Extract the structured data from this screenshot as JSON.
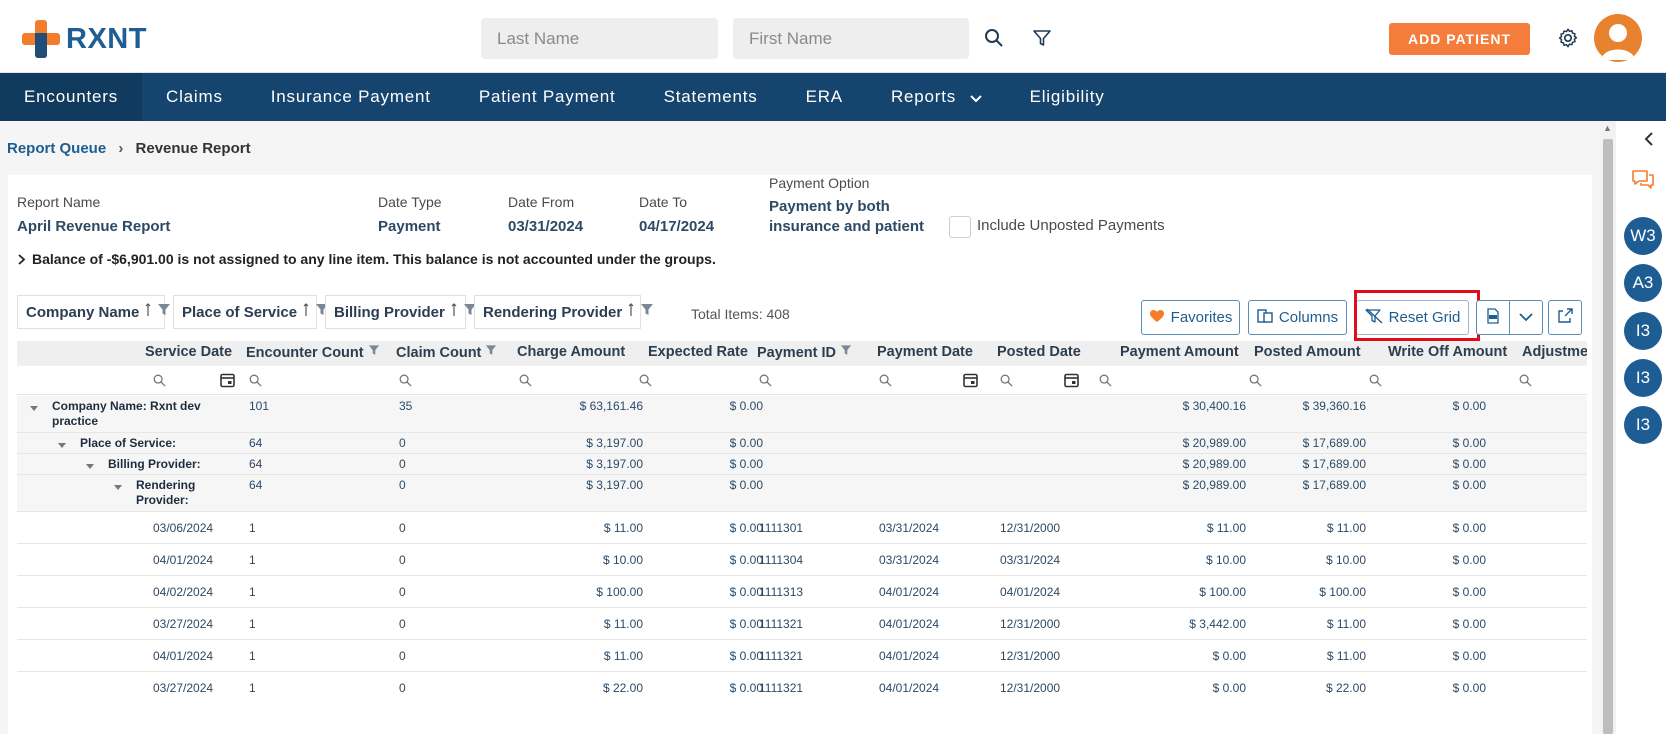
{
  "header": {
    "logo_text": "RXNT",
    "last_name_placeholder": "Last Name",
    "first_name_placeholder": "First Name",
    "add_patient_label": "ADD PATIENT"
  },
  "nav": {
    "items": [
      "Encounters",
      "Claims",
      "Insurance Payment",
      "Patient Payment",
      "Statements",
      "ERA",
      "Reports",
      "Eligibility"
    ]
  },
  "breadcrumb": {
    "parent": "Report Queue",
    "separator": "›",
    "current": "Revenue Report"
  },
  "report": {
    "name_label": "Report Name",
    "name_value": "April Revenue Report",
    "date_type_label": "Date Type",
    "date_type_value": "Payment",
    "date_from_label": "Date From",
    "date_from_value": "03/31/2024",
    "date_to_label": "Date To",
    "date_to_value": "04/17/2024",
    "payment_option_label": "Payment Option",
    "payment_option_line1": "Payment by both",
    "payment_option_line2": "insurance and patient",
    "include_unposted_label": "Include Unposted Payments",
    "balance_notice": "Balance of -$6,901.00 is not assigned to any line item. This balance is not accounted under the groups."
  },
  "group_chips": [
    "Company Name",
    "Place of Service",
    "Billing Provider",
    "Rendering Provider"
  ],
  "total_items": "Total Items: 408",
  "toolbar": {
    "favorites": "Favorites",
    "columns": "Columns",
    "reset_grid": "Reset Grid"
  },
  "columns": [
    "Service Date",
    "Encounter Count",
    "Claim Count",
    "Charge Amount",
    "Expected Rate",
    "Payment ID",
    "Payment Date",
    "Posted Date",
    "Payment Amount",
    "Posted Amount",
    "Write Off Amount",
    "Adjustme"
  ],
  "group_rows": [
    {
      "label1": "Company Name: Rxnt dev",
      "label2": "practice",
      "encounter": "101",
      "claim": "35",
      "charge": "$ 63,161.46",
      "expected": "$ 0.00",
      "payment_amount": "$ 30,400.16",
      "posted_amount": "$ 39,360.16",
      "write_off": "$ 0.00"
    },
    {
      "label1": "Place of Service:",
      "label2": "",
      "encounter": "64",
      "claim": "0",
      "charge": "$ 3,197.00",
      "expected": "$ 0.00",
      "payment_amount": "$ 20,989.00",
      "posted_amount": "$ 17,689.00",
      "write_off": "$ 0.00"
    },
    {
      "label1": "Billing Provider:",
      "label2": "",
      "encounter": "64",
      "claim": "0",
      "charge": "$ 3,197.00",
      "expected": "$ 0.00",
      "payment_amount": "$ 20,989.00",
      "posted_amount": "$ 17,689.00",
      "write_off": "$ 0.00"
    },
    {
      "label1": "Rendering",
      "label2": "Provider:",
      "encounter": "64",
      "claim": "0",
      "charge": "$ 3,197.00",
      "expected": "$ 0.00",
      "payment_amount": "$ 20,989.00",
      "posted_amount": "$ 17,689.00",
      "write_off": "$ 0.00"
    }
  ],
  "data_rows": [
    {
      "service_date": "03/06/2024",
      "encounter": "1",
      "claim": "0",
      "charge": "$ 11.00",
      "expected": "$ 0.00",
      "payment_id": "1111301",
      "payment_date": "03/31/2024",
      "posted_date": "12/31/2000",
      "payment_amount": "$ 11.00",
      "posted_amount": "$ 11.00",
      "write_off": "$ 0.00"
    },
    {
      "service_date": "04/01/2024",
      "encounter": "1",
      "claim": "0",
      "charge": "$ 10.00",
      "expected": "$ 0.00",
      "payment_id": "1111304",
      "payment_date": "03/31/2024",
      "posted_date": "03/31/2024",
      "payment_amount": "$ 10.00",
      "posted_amount": "$ 10.00",
      "write_off": "$ 0.00"
    },
    {
      "service_date": "04/02/2024",
      "encounter": "1",
      "claim": "0",
      "charge": "$ 100.00",
      "expected": "$ 0.00",
      "payment_id": "1111313",
      "payment_date": "04/01/2024",
      "posted_date": "04/01/2024",
      "payment_amount": "$ 100.00",
      "posted_amount": "$ 100.00",
      "write_off": "$ 0.00"
    },
    {
      "service_date": "03/27/2024",
      "encounter": "1",
      "claim": "0",
      "charge": "$ 11.00",
      "expected": "$ 0.00",
      "payment_id": "1111321",
      "payment_date": "04/01/2024",
      "posted_date": "12/31/2000",
      "payment_amount": "$ 3,442.00",
      "posted_amount": "$ 11.00",
      "write_off": "$ 0.00"
    },
    {
      "service_date": "04/01/2024",
      "encounter": "1",
      "claim": "0",
      "charge": "$ 11.00",
      "expected": "$ 0.00",
      "payment_id": "1111321",
      "payment_date": "04/01/2024",
      "posted_date": "12/31/2000",
      "payment_amount": "$ 0.00",
      "posted_amount": "$ 11.00",
      "write_off": "$ 0.00"
    },
    {
      "service_date": "03/27/2024",
      "encounter": "1",
      "claim": "0",
      "charge": "$ 22.00",
      "expected": "$ 0.00",
      "payment_id": "1111321",
      "payment_date": "04/01/2024",
      "posted_date": "12/31/2000",
      "payment_amount": "$ 0.00",
      "posted_amount": "$ 22.00",
      "write_off": "$ 0.00"
    }
  ],
  "rail": {
    "avatars": [
      "W3",
      "A3",
      "I3",
      "I3",
      "I3"
    ]
  },
  "colors": {
    "brand_orange": "#f47d2c",
    "brand_blue": "#1f5e93",
    "nav_bg": "#15446e",
    "highlight_red": "#e00d1c"
  }
}
